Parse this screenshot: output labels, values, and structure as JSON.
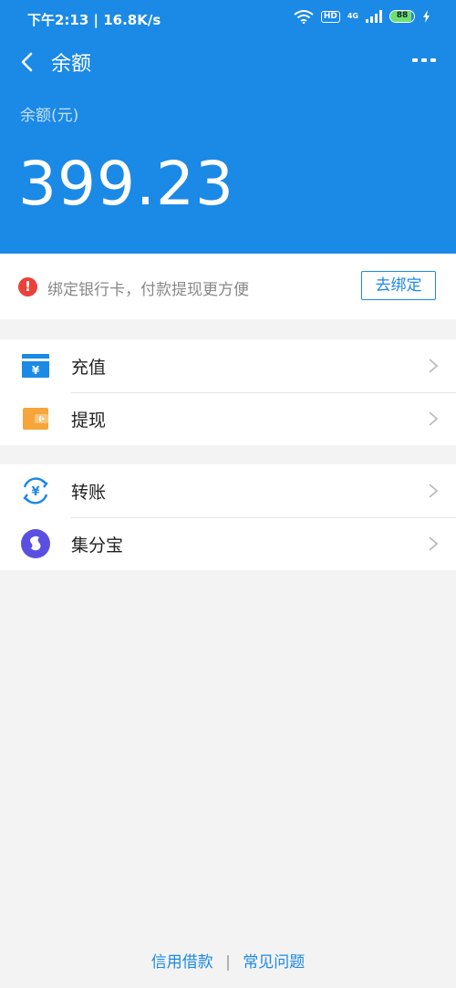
{
  "status_bar": {
    "time": "下午2:13 | 16.8K/s",
    "hd": "HD",
    "network": "4G",
    "battery": "88",
    "battery_level": 0.88
  },
  "header": {
    "title": "余额",
    "balance_label": "余额(元)",
    "balance_value": "399.23",
    "bg_color": "#1b89e6"
  },
  "notice": {
    "icon": "warning-icon",
    "icon_glyph": "!",
    "text": "绑定银行卡，付款提现更方便",
    "button_label": "去绑定"
  },
  "group1": [
    {
      "label": "充值",
      "icon": "recharge-icon"
    },
    {
      "label": "提现",
      "icon": "wallet-icon"
    }
  ],
  "group2": [
    {
      "label": "转账",
      "icon": "transfer-icon"
    },
    {
      "label": "集分宝",
      "icon": "jifenbao-icon"
    }
  ],
  "footer": {
    "left_link": "信用借款",
    "separator": "|",
    "right_link": "常见问题"
  }
}
